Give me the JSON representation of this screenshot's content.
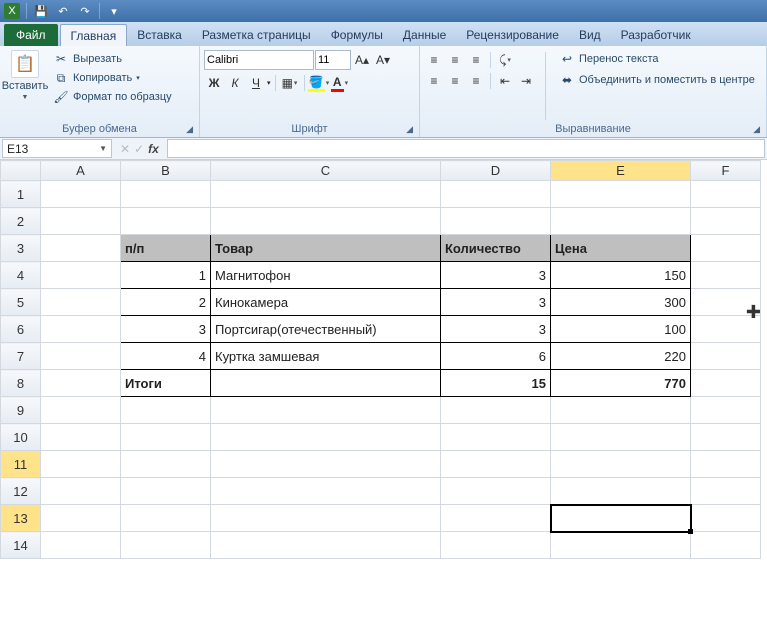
{
  "qat": {
    "icons": [
      "excel",
      "save",
      "undo",
      "redo",
      "print",
      "open"
    ]
  },
  "tabs": {
    "file": "Файл",
    "items": [
      "Главная",
      "Вставка",
      "Разметка страницы",
      "Формулы",
      "Данные",
      "Рецензирование",
      "Вид",
      "Разработчик"
    ],
    "active": 0
  },
  "ribbon": {
    "paste": "Вставить",
    "clipboard": {
      "cut": "Вырезать",
      "copy": "Копировать",
      "format_painter": "Формат по образцу",
      "label": "Буфер обмена"
    },
    "font": {
      "name": "Calibri",
      "size": "11",
      "label": "Шрифт"
    },
    "alignment": {
      "wrap": "Перенос текста",
      "merge": "Объединить и поместить в центре",
      "label": "Выравнивание"
    }
  },
  "namebox": "E13",
  "formula": "",
  "columns": [
    "A",
    "B",
    "C",
    "D",
    "E",
    "F"
  ],
  "rows": [
    "1",
    "2",
    "3",
    "4",
    "5",
    "6",
    "7",
    "8",
    "9",
    "10",
    "11",
    "12",
    "13",
    "14"
  ],
  "selected_col": "E",
  "selected_row_a": "11",
  "selected_row_b": "13",
  "sheet": {
    "header": {
      "pp": "п/п",
      "product": "Товар",
      "qty": "Количество",
      "price": "Цена"
    },
    "rows": [
      {
        "n": "1",
        "product": "Магнитофон",
        "qty": "3",
        "price": "150"
      },
      {
        "n": "2",
        "product": "Кинокамера",
        "qty": "3",
        "price": "300"
      },
      {
        "n": "3",
        "product": "Портсигар(отечественный)",
        "qty": "3",
        "price": "100"
      },
      {
        "n": "4",
        "product": "Куртка замшевая",
        "qty": "6",
        "price": "220"
      }
    ],
    "totals": {
      "label": "Итоги",
      "qty": "15",
      "price": "770"
    }
  }
}
